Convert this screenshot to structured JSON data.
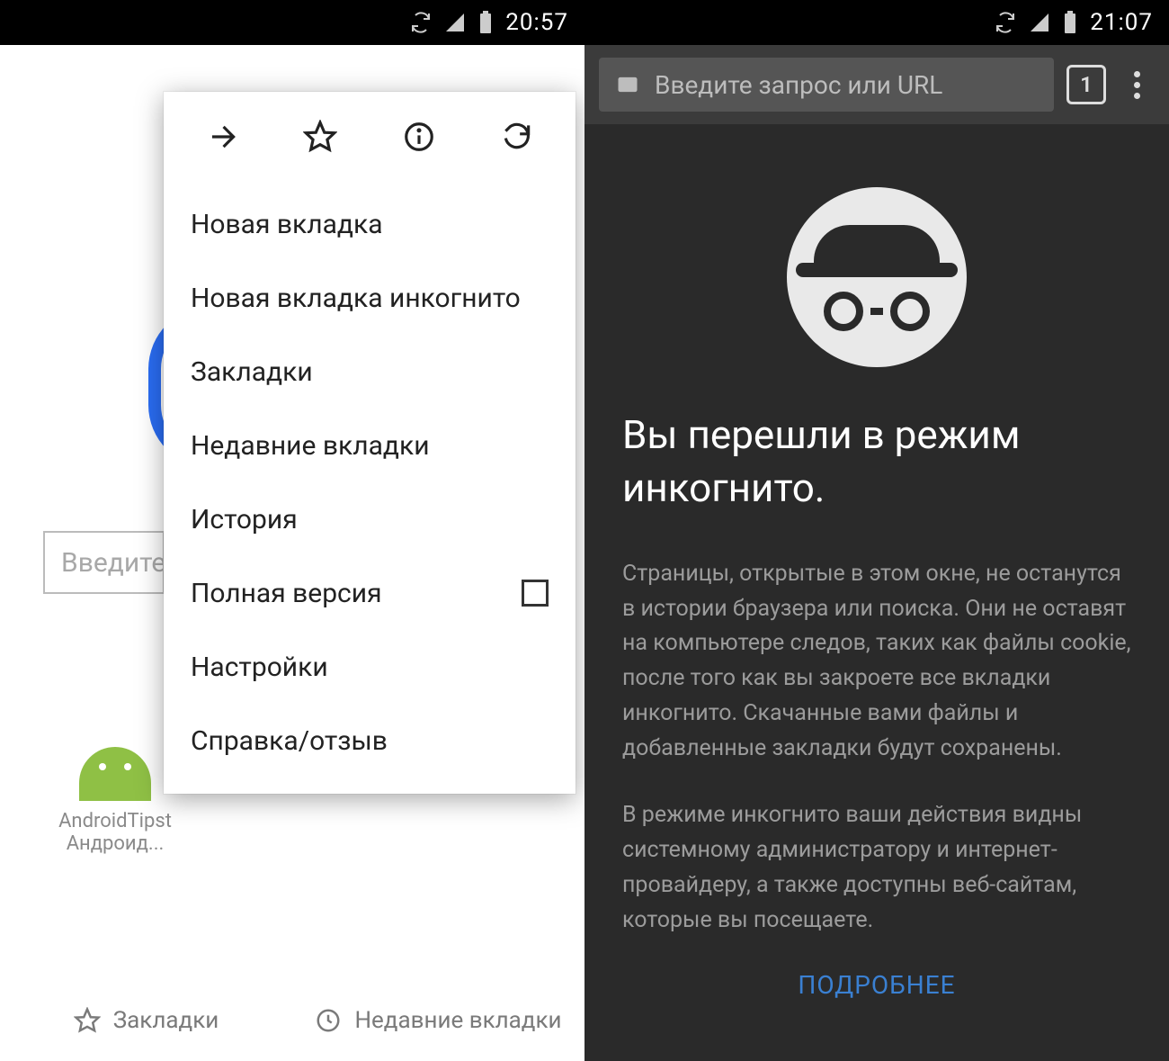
{
  "left": {
    "status": {
      "time": "20:57"
    },
    "search_placeholder": "Введите",
    "shortcut": {
      "line1": "AndroidTipst",
      "line2": "Андроид..."
    },
    "bottom": {
      "bookmarks": "Закладки",
      "recent": "Недавние вкладки"
    },
    "menu": {
      "items": [
        "Новая вкладка",
        "Новая вкладка инкогнито",
        "Закладки",
        "Недавние вкладки",
        "История",
        "Полная версия",
        "Настройки",
        "Справка/отзыв"
      ]
    }
  },
  "right": {
    "status": {
      "time": "21:07"
    },
    "omnibox_placeholder": "Введите запрос или URL",
    "tab_count": "1",
    "title": "Вы перешли в режим инкогнито.",
    "p1": "Страницы, открытые в этом окне, не останутся в истории браузера или поиска. Они не оставят на компьютере следов, таких как файлы cookie, после того как вы закроете все вкладки инкогнито. Скачанные вами файлы и добавленные закладки будут сохранены.",
    "p2": "В режиме инкогнито ваши действия видны системному администратору и интернет-провайдеру, а также доступны веб-сайтам, которые вы посещаете.",
    "more": "ПОДРОБНЕЕ"
  }
}
